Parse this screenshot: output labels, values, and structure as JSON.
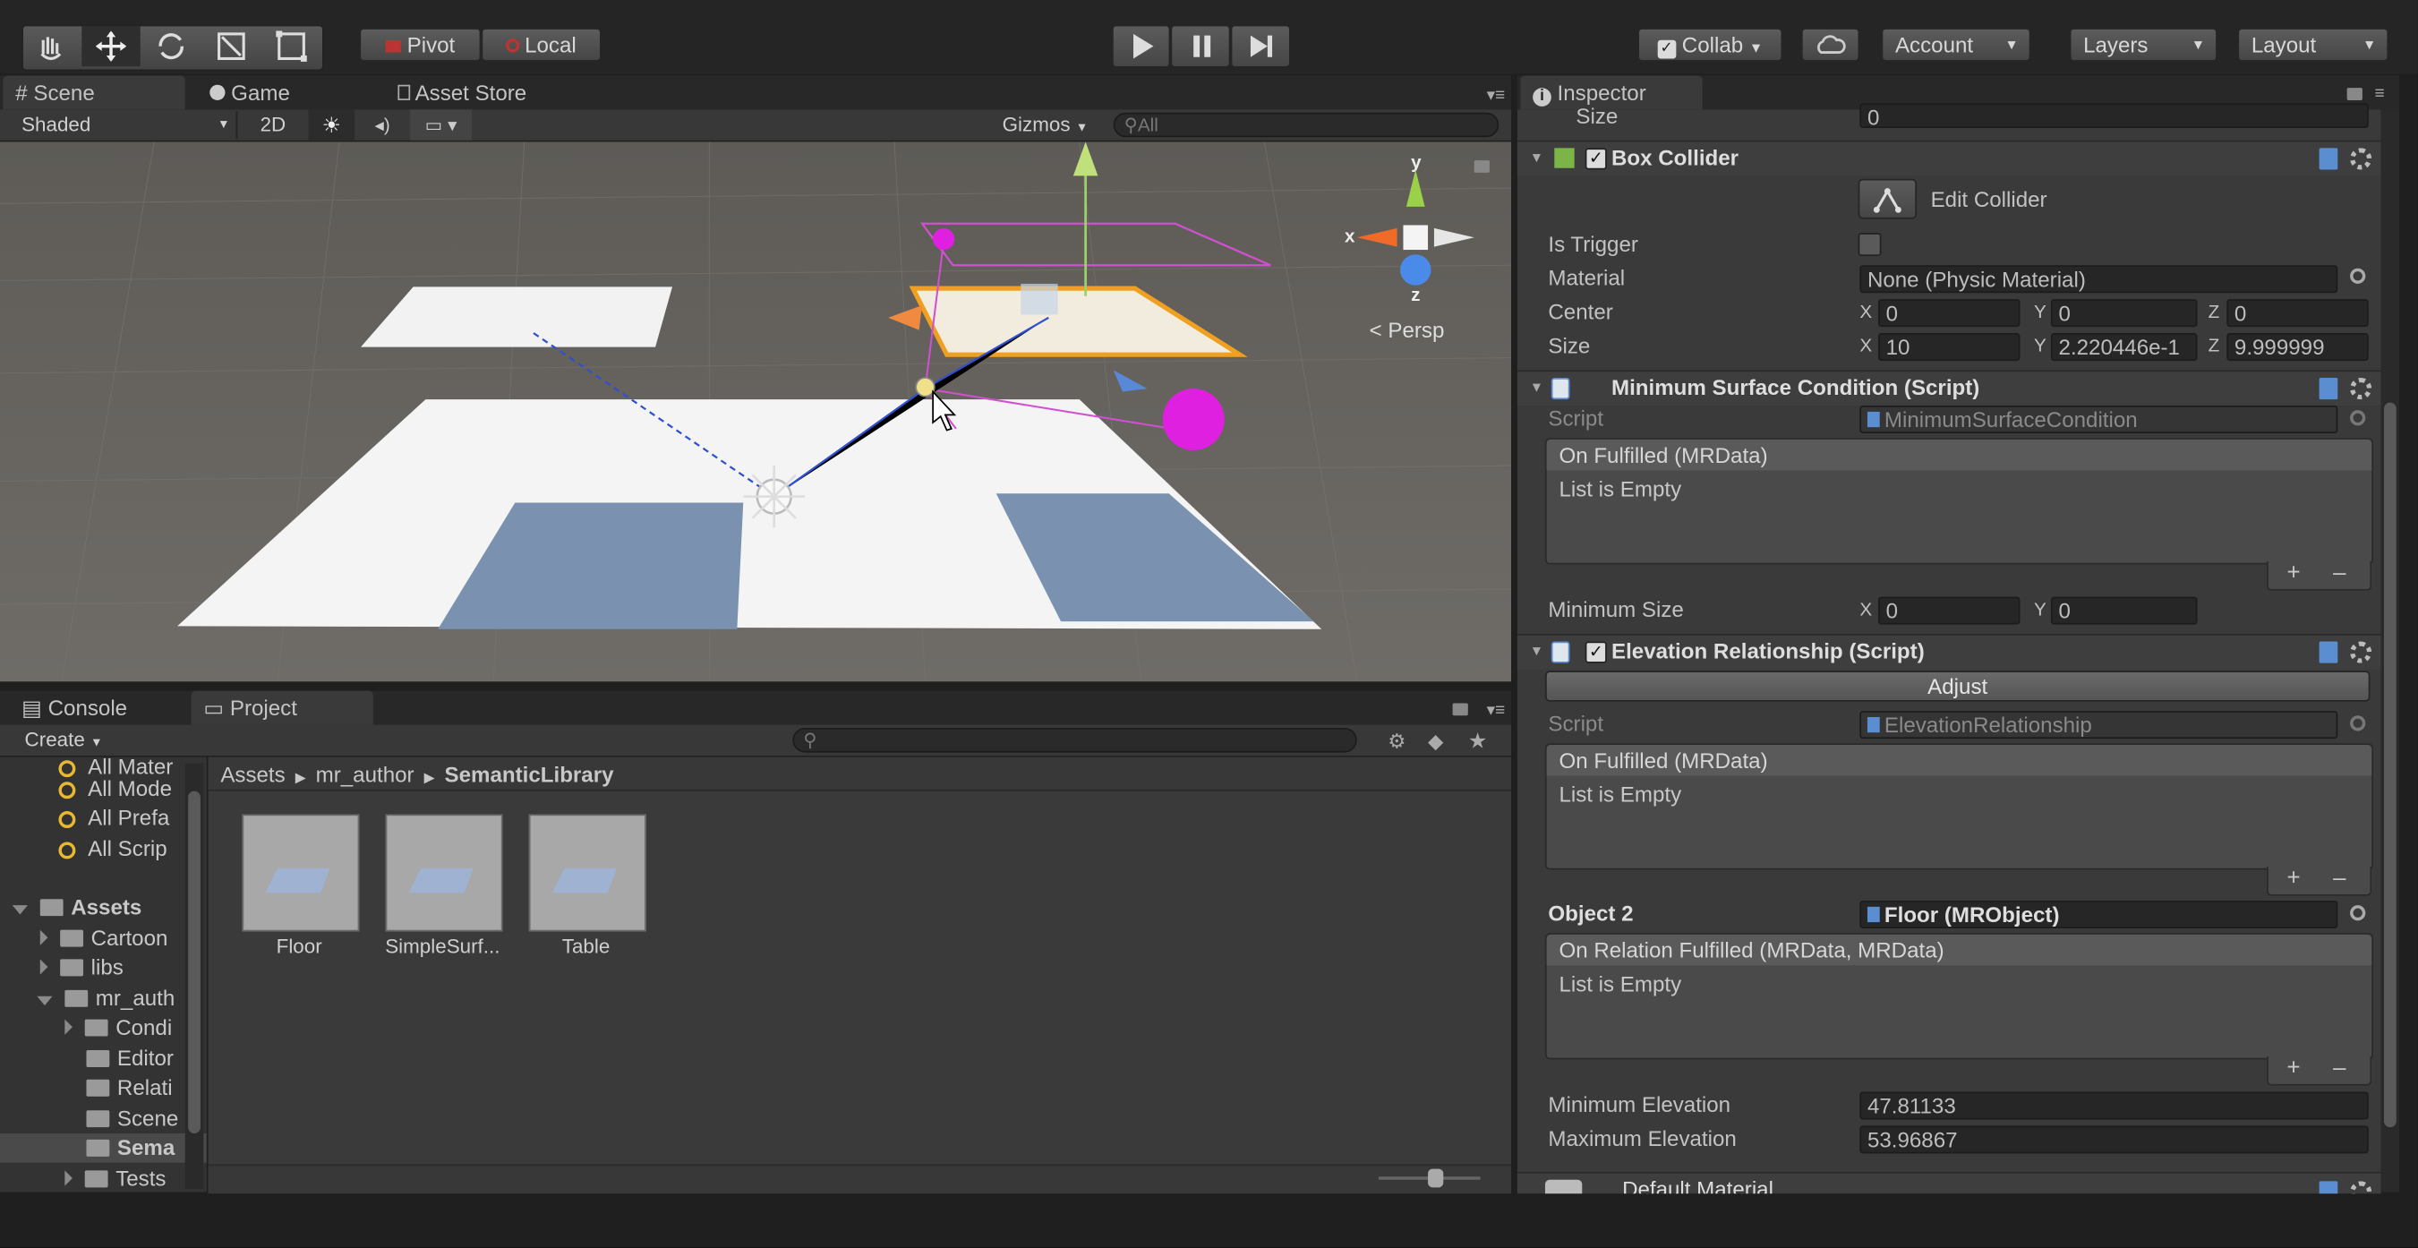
{
  "toolbar": {
    "pivot_label": "Pivot",
    "local_label": "Local",
    "collab_label": "Collab",
    "account_label": "Account",
    "layers_label": "Layers",
    "layout_label": "Layout"
  },
  "scene_tabs": {
    "scene": "Scene",
    "game": "Game",
    "asset_store": "Asset Store"
  },
  "scene_toolbar": {
    "shading_mode": "Shaded",
    "mode_2d": "2D",
    "gizmos_label": "Gizmos",
    "search_placeholder": "All"
  },
  "scene_gizmo": {
    "y": "y",
    "x": "x",
    "z": "z",
    "persp_label": "Persp"
  },
  "bottom_tabs": {
    "console": "Console",
    "project": "Project"
  },
  "project": {
    "create_label": "Create",
    "search_placeholder": "",
    "favorites": [
      "All Mater",
      "All Mode",
      "All Prefa",
      "All Scrip"
    ],
    "tree": [
      {
        "label": "Assets",
        "bold": true
      },
      {
        "label": "Cartoon"
      },
      {
        "label": "libs"
      },
      {
        "label": "mr_auth"
      },
      {
        "label": "Condi"
      },
      {
        "label": "Editor"
      },
      {
        "label": "Relati"
      },
      {
        "label": "Scene"
      },
      {
        "label": "Sema"
      },
      {
        "label": "Tests"
      }
    ],
    "breadcrumb": [
      "Assets",
      "mr_author",
      "SemanticLibrary"
    ],
    "assets": [
      "Floor",
      "SimpleSurf...",
      "Table"
    ]
  },
  "inspector": {
    "tab_label": "Inspector",
    "top_size_label": "Size",
    "top_size_value": "0",
    "box_collider": {
      "title": "Box Collider",
      "edit_collider": "Edit Collider",
      "is_trigger_label": "Is Trigger",
      "material_label": "Material",
      "material_value": "None (Physic Material)",
      "center_label": "Center",
      "center": {
        "x": "0",
        "y": "0",
        "z": "0"
      },
      "size_label": "Size",
      "size": {
        "x": "10",
        "y": "2.220446e-1",
        "z": "9.999999"
      }
    },
    "min_surface": {
      "title": "Minimum Surface Condition (Script)",
      "script_label": "Script",
      "script_value": "MinimumSurfaceCondition",
      "event_header": "On Fulfilled (MRData)",
      "event_body": "List is Empty",
      "min_size_label": "Minimum Size",
      "min_size": {
        "x": "0",
        "y": "0"
      }
    },
    "elevation": {
      "title": "Elevation Relationship (Script)",
      "adjust_label": "Adjust",
      "script_label": "Script",
      "script_value": "ElevationRelationship",
      "event_header": "On Fulfilled (MRData)",
      "event_body": "List is Empty",
      "object2_label": "Object 2",
      "object2_value": "Floor (MRObject)",
      "relation_header": "On Relation Fulfilled (MRData, MRData)",
      "relation_body": "List is Empty",
      "min_elev_label": "Minimum Elevation",
      "min_elev_value": "47.81133",
      "max_elev_label": "Maximum Elevation",
      "max_elev_value": "53.96867"
    },
    "default_material": "Default Material"
  },
  "axis_letters": {
    "x": "X",
    "y": "Y",
    "z": "Z"
  },
  "colors": {
    "accent_orange": "#f0a020",
    "magenta": "#e020e0",
    "selection_blue": "#5a8ed0"
  }
}
